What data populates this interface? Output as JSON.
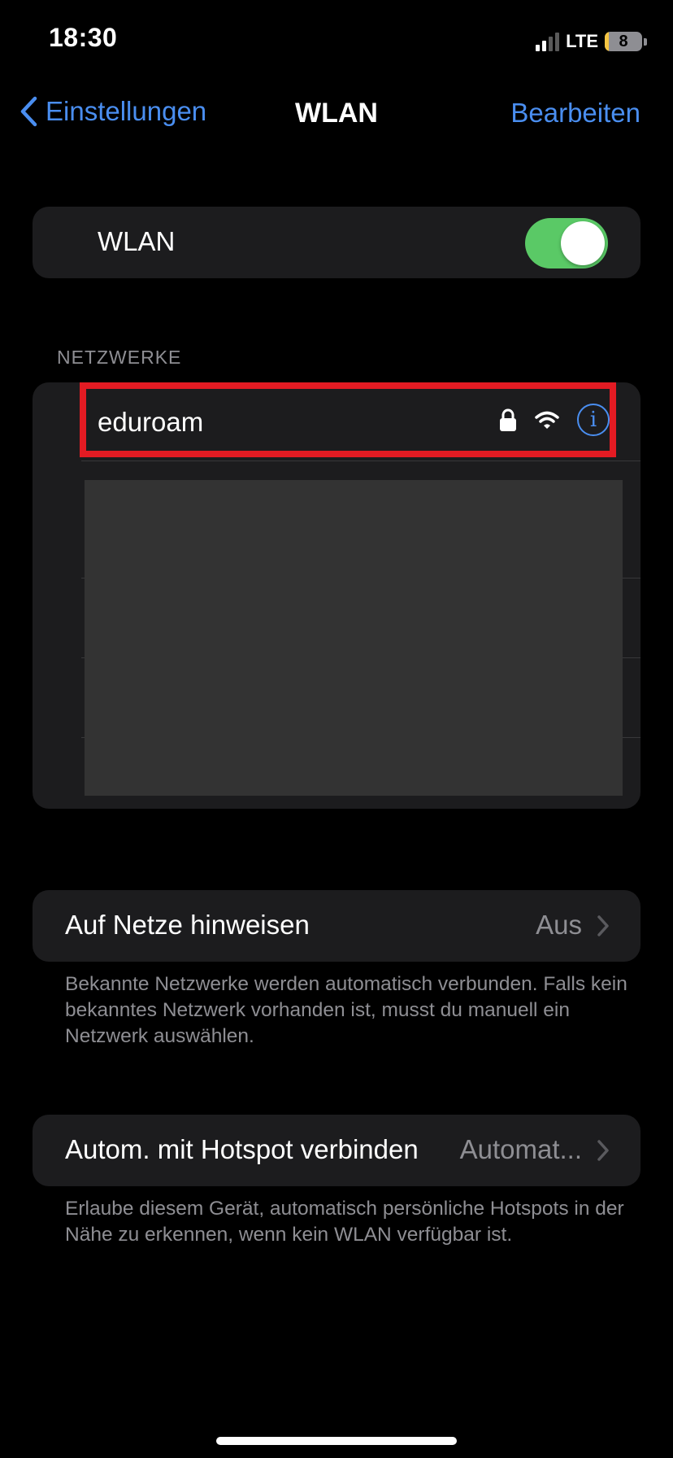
{
  "status_bar": {
    "time": "18:30",
    "network": "LTE",
    "battery_level": "8"
  },
  "nav": {
    "back_label": "Einstellungen",
    "title": "WLAN",
    "edit_label": "Bearbeiten"
  },
  "wlan_toggle": {
    "label": "WLAN",
    "on": true,
    "color": "#5ac966"
  },
  "networks": {
    "section_header": "NETZWERKE",
    "items": [
      {
        "name": "eduroam",
        "secured": true,
        "icons": [
          "lock-icon",
          "wifi-icon",
          "info-icon"
        ]
      }
    ]
  },
  "ask_to_join": {
    "label": "Auf Netze hinweisen",
    "value": "Aus",
    "footnote": "Bekannte Netzwerke werden automatisch verbunden. Falls kein bekanntes Netzwerk vorhanden ist, musst du manuell ein Netzwerk auswählen."
  },
  "auto_hotspot": {
    "label": "Autom. mit Hotspot verbinden",
    "value": "Automat...",
    "footnote": "Erlaube diesem Gerät, automatisch persönliche Hotspots in der Nähe zu erkennen, wenn kein WLAN verfügbar ist."
  },
  "colors": {
    "accent": "#4a8ef0",
    "highlight": "#e31b23",
    "background": "#000000",
    "card": "#1c1c1e"
  }
}
